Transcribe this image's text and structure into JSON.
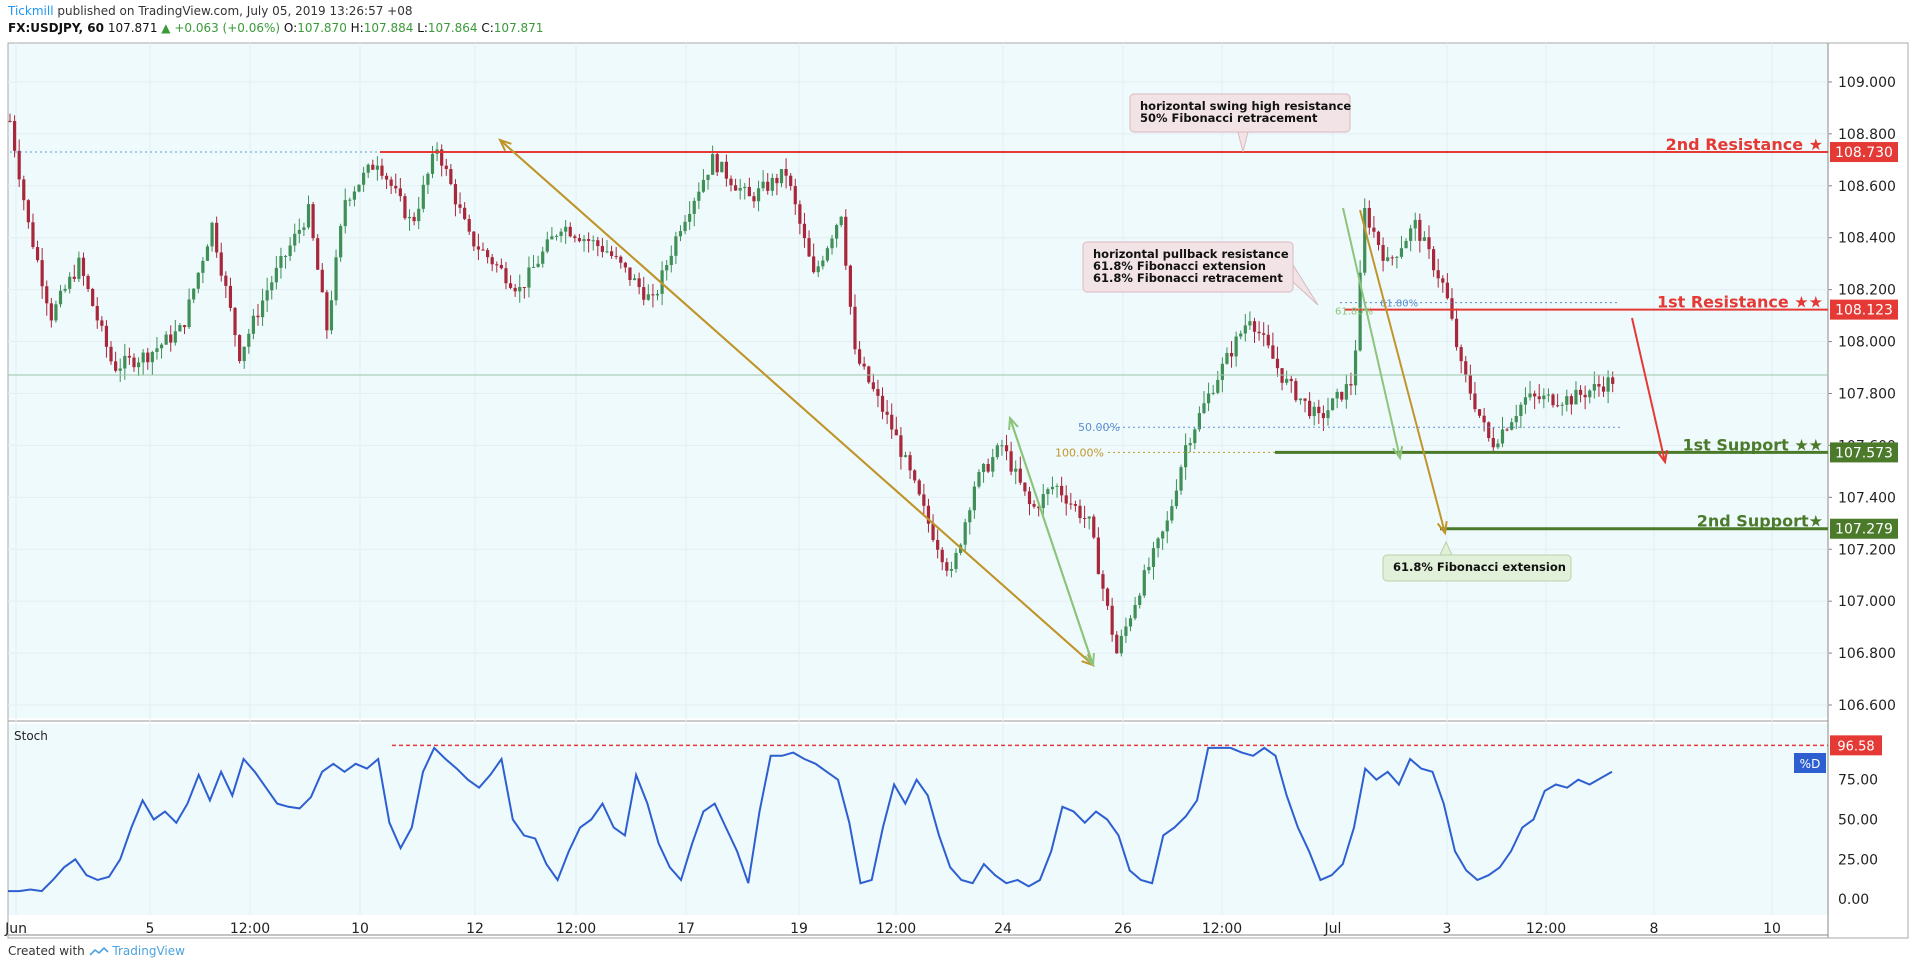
{
  "header": {
    "author": "Tickmill",
    "published": "published on TradingView.com, July 05, 2019 13:26:57 +08",
    "symbol": "FX:USDJPY, 60",
    "last": "107.871",
    "change": "▲ +0.063 (+0.06%)",
    "o_label": "O:",
    "o": "107.870",
    "h_label": "H:",
    "h": "107.884",
    "l_label": "L:",
    "l": "107.864",
    "c_label": "C:",
    "c": "107.871"
  },
  "footer": {
    "created": "Created with",
    "brand": "TradingView"
  },
  "colors": {
    "chart_bg": "#effafd",
    "up": "#3f8f56",
    "down": "#a8273a",
    "resistance": "#e53935",
    "support": "#4a7a2a",
    "fib_gold": "#c0962c",
    "fib_green": "#8cc47a",
    "stoch": "#2d5fd0",
    "grid": "#e3eef2"
  },
  "chart_data": [
    {
      "type": "candlestick",
      "symbol": "FX:USDJPY",
      "interval": "60",
      "ylim": [
        106.55,
        109.15
      ],
      "y_ticks": [
        "109.000",
        "108.800",
        "108.600",
        "108.400",
        "108.200",
        "108.000",
        "107.800",
        "107.600",
        "107.400",
        "107.200",
        "107.000",
        "106.800",
        "106.600"
      ],
      "x_ticks": [
        "Jun",
        "5",
        "12:00",
        "10",
        "12",
        "12:00",
        "17",
        "19",
        "12:00",
        "24",
        "26",
        "12:00",
        "Jul",
        "3",
        "12:00",
        "8",
        "10"
      ],
      "price_path": [
        [
          0,
          108.85
        ],
        [
          8,
          108.45
        ],
        [
          18,
          108.1
        ],
        [
          30,
          108.3
        ],
        [
          45,
          107.9
        ],
        [
          60,
          107.95
        ],
        [
          75,
          108.05
        ],
        [
          88,
          108.45
        ],
        [
          100,
          107.95
        ],
        [
          112,
          108.2
        ],
        [
          130,
          108.5
        ],
        [
          138,
          108.05
        ],
        [
          146,
          108.55
        ],
        [
          160,
          108.7
        ],
        [
          175,
          108.45
        ],
        [
          186,
          108.75
        ],
        [
          200,
          108.4
        ],
        [
          222,
          108.2
        ],
        [
          240,
          108.45
        ],
        [
          260,
          108.35
        ],
        [
          280,
          108.15
        ],
        [
          292,
          108.45
        ],
        [
          306,
          108.7
        ],
        [
          322,
          108.55
        ],
        [
          338,
          108.65
        ],
        [
          350,
          108.25
        ],
        [
          362,
          108.5
        ],
        [
          368,
          107.95
        ],
        [
          385,
          107.65
        ],
        [
          400,
          107.3
        ],
        [
          410,
          107.1
        ],
        [
          420,
          107.45
        ],
        [
          432,
          107.6
        ],
        [
          445,
          107.35
        ],
        [
          455,
          107.45
        ],
        [
          470,
          107.3
        ],
        [
          482,
          106.8
        ],
        [
          492,
          107.05
        ],
        [
          504,
          107.3
        ],
        [
          512,
          107.6
        ],
        [
          525,
          107.85
        ],
        [
          540,
          108.1
        ],
        [
          555,
          107.85
        ],
        [
          570,
          107.7
        ],
        [
          585,
          107.85
        ],
        [
          590,
          108.5
        ],
        [
          600,
          108.3
        ],
        [
          612,
          108.45
        ],
        [
          625,
          108.2
        ],
        [
          632,
          107.9
        ],
        [
          645,
          107.6
        ],
        [
          660,
          107.78
        ],
        [
          680,
          107.78
        ],
        [
          700,
          107.86
        ]
      ],
      "levels": [
        {
          "label": "2nd Resistance ★",
          "value": 108.73,
          "value_label": "108.730",
          "kind": "resistance"
        },
        {
          "label": "1st Resistance ★★",
          "value": 108.123,
          "value_label": "108.123",
          "kind": "resistance"
        },
        {
          "label": "1st Support ★★",
          "value": 107.573,
          "value_label": "107.573",
          "kind": "support"
        },
        {
          "label": "2nd Support★",
          "value": 107.279,
          "value_label": "107.279",
          "kind": "support"
        }
      ],
      "fib_labels": [
        "50.00%",
        "100.00%",
        "61.80%",
        "61.80%"
      ],
      "annotations": [
        {
          "lines": [
            "horizontal swing high resistance",
            "50% Fibonacci retracement"
          ]
        },
        {
          "lines": [
            "horizontal pullback resistance",
            "61.8% Fibonacci extension",
            "61.8% Fibonacci retracement"
          ]
        },
        {
          "lines": [
            "61.8% Fibonacci extension"
          ]
        }
      ]
    },
    {
      "type": "line",
      "name": "Stoch",
      "series": [
        {
          "name": "%D",
          "values": [
            5,
            5,
            6,
            5,
            12,
            20,
            25,
            15,
            12,
            14,
            25,
            45,
            62,
            50,
            55,
            48,
            60,
            78,
            62,
            80,
            65,
            88,
            80,
            70,
            60,
            58,
            57,
            64,
            80,
            85,
            80,
            85,
            82,
            88,
            48,
            32,
            45,
            80,
            95,
            88,
            82,
            75,
            70,
            78,
            88,
            50,
            40,
            38,
            22,
            12,
            30,
            45,
            50,
            60,
            45,
            40,
            78,
            60,
            35,
            20,
            12,
            35,
            55,
            60,
            45,
            30,
            10,
            55,
            90,
            90,
            92,
            88,
            85,
            80,
            75,
            48,
            10,
            12,
            45,
            72,
            60,
            75,
            65,
            40,
            20,
            12,
            10,
            22,
            15,
            10,
            12,
            8,
            12,
            30,
            58,
            55,
            48,
            55,
            50,
            40,
            18,
            12,
            10,
            40,
            45,
            52,
            62,
            95,
            95,
            95,
            92,
            90,
            95,
            90,
            65,
            45,
            30,
            12,
            15,
            22,
            45,
            82,
            75,
            80,
            72,
            88,
            82,
            80,
            60,
            30,
            18,
            12,
            15,
            20,
            30,
            45,
            50,
            68,
            72,
            70,
            75,
            72,
            76,
            80
          ]
        }
      ],
      "ylim": [
        -10,
        110
      ],
      "y_ticks": [
        "75.00",
        "50.00",
        "25.00",
        "0.00"
      ],
      "top_level_label": "96.58",
      "top_level_value": 96.58
    }
  ]
}
